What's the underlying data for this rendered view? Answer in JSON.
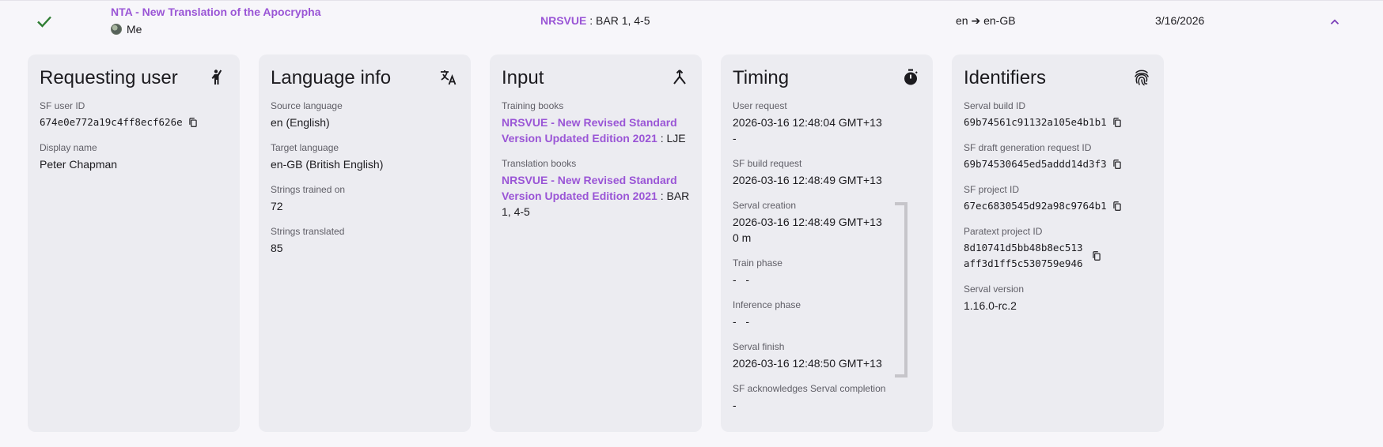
{
  "summary": {
    "project_link": "NTA - New Translation of the Apocrypha",
    "requester": "Me",
    "books_code": "NRSVUE",
    "books_rest": " : BAR 1, 4-5",
    "languages": "en ➔ en-GB",
    "date": "3/16/2026"
  },
  "requesting_user": {
    "title": "Requesting user",
    "sf_user_id_label": "SF user ID",
    "sf_user_id": "674e0e772a19c4ff8ecf626e",
    "display_name_label": "Display name",
    "display_name": "Peter Chapman"
  },
  "language_info": {
    "title": "Language info",
    "source_label": "Source language",
    "source": "en (English)",
    "target_label": "Target language",
    "target": "en-GB (British English)",
    "trained_label": "Strings trained on",
    "trained": "72",
    "translated_label": "Strings translated",
    "translated": "85"
  },
  "input": {
    "title": "Input",
    "training_label": "Training books",
    "training_link": "NRSVUE - New Revised Standard Version Updated Edition 2021",
    "training_rest": " : LJE",
    "translation_label": "Translation books",
    "translation_link": "NRSVUE - New Revised Standard Version Updated Edition 2021",
    "translation_rest": " : BAR 1, 4-5"
  },
  "timing": {
    "title": "Timing",
    "user_request_label": "User request",
    "user_request": "2026-03-16 12:48:04 GMT+13",
    "user_request_duration": "-",
    "sf_build_label": "SF build request",
    "sf_build": "2026-03-16 12:48:49 GMT+13",
    "serval_creation_label": "Serval creation",
    "serval_creation": "2026-03-16 12:48:49 GMT+13",
    "serval_creation_duration": "0 m",
    "train_label": "Train phase",
    "train": "-   -",
    "inference_label": "Inference phase",
    "inference": "-   -",
    "serval_finish_label": "Serval finish",
    "serval_finish": "2026-03-16 12:48:50 GMT+13",
    "ack_label": "SF acknowledges Serval completion",
    "ack": "-"
  },
  "identifiers": {
    "title": "Identifiers",
    "build_id_label": "Serval build ID",
    "build_id": "69b74561c91132a105e4b1b1",
    "draft_req_label": "SF draft generation request ID",
    "draft_req": "69b74530645ed5addd14d3f3",
    "project_id_label": "SF project ID",
    "project_id": "67ec6830545d92a98c9764b1",
    "paratext_label": "Paratext project ID",
    "paratext_line1": "8d10741d5bb48b8ec513",
    "paratext_line2": "aff3d1ff5c530759e946",
    "version_label": "Serval version",
    "version": "1.16.0-rc.2"
  },
  "colors": {
    "accent": "#9a55d6",
    "success": "#2e7d32",
    "card_bg": "#ececf1",
    "page_bg": "#f7f6fa"
  },
  "icons": {
    "status": "check-icon",
    "collapse": "chevron-up-icon",
    "requesting_user": "person-raised-hand-icon",
    "language_info": "translate-icon",
    "input": "merge-icon",
    "timing": "timer-icon",
    "identifiers": "fingerprint-icon",
    "copy": "copy-icon"
  }
}
